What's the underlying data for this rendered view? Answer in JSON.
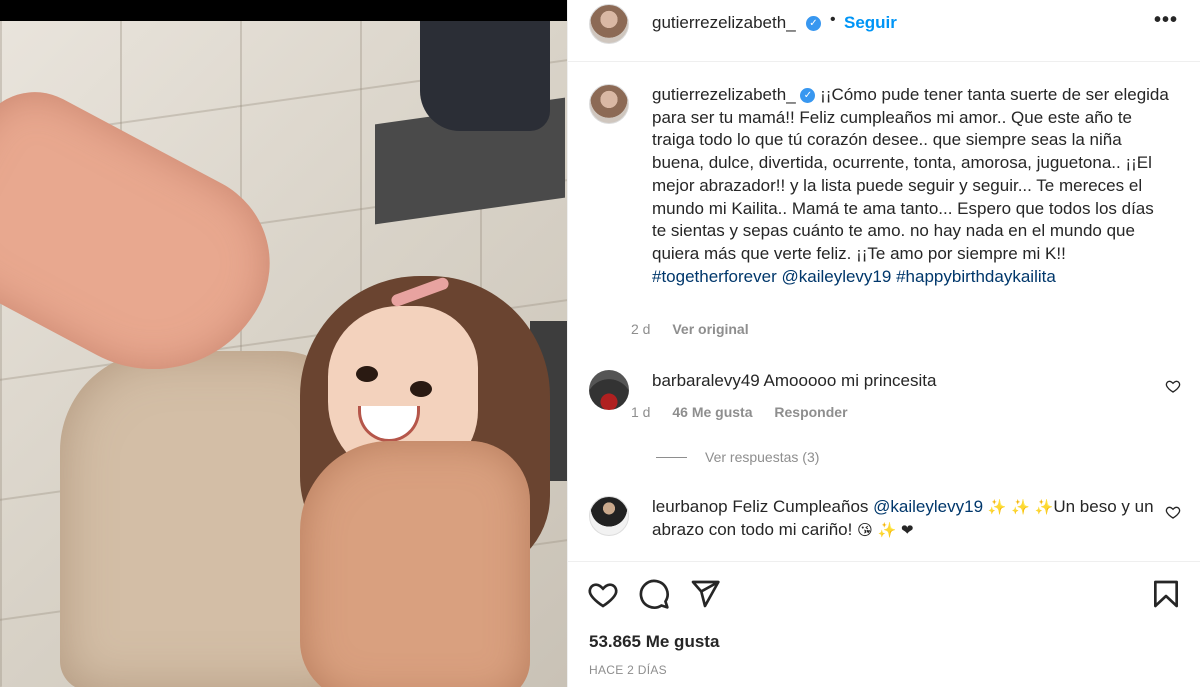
{
  "post": {
    "username": "gutierrezelizabeth_",
    "follow_label": "Seguir",
    "dot": "•",
    "more_label": "•••",
    "next_arrow": "›",
    "caption": {
      "text": "¡¡Cómo pude tener tanta suerte de ser elegida para ser tu mamá!! Feliz cumpleaños mi amor.. Que este año te traiga todo lo que tú corazón desee.. que siempre seas la niña buena, dulce, divertida, ocurrente, tonta, amorosa, juguetona.. ¡¡El mejor abrazador!! y la lista puede seguir y seguir... Te mereces el mundo mi Kailita.. Mamá te ama tanto... Espero que todos los días te sientas y sepas cuánto te amo. no hay nada en el mundo que quiera más que verte feliz. ¡¡Te amo por siempre mi K!!",
      "hashtag1": "#togetherforever",
      "mention": "@kaileylevy19",
      "hashtag2": "#happybirthdaykailita",
      "age": "2 d",
      "see_original": "Ver original"
    },
    "comments": [
      {
        "username": "barbaralevy49",
        "text": "Amooooo mi princesita",
        "age": "1 d",
        "likes": "46 Me gusta",
        "reply_label": "Responder",
        "view_replies": "Ver respuestas (3)"
      },
      {
        "username": "leurbanop",
        "text_before": "Feliz Cumpleaños",
        "mention": "@kaileylevy19",
        "emoji_sparkles": "✨ ✨ ✨",
        "text_after": "Un beso y un abrazo con todo mi cariño!",
        "emoji_end": "😘 ✨ ❤"
      }
    ],
    "likes_count": "53.865 Me gusta",
    "posted_ago": "HACE 2 DÍAS"
  },
  "colors": {
    "link_blue": "#0095f6",
    "hashtag": "#00376b",
    "muted": "#8e8e8e",
    "text": "#262626",
    "verified": "#3897f0"
  },
  "icons": [
    "verified-badge-icon",
    "more-options-icon",
    "next-arrow-icon",
    "heart-icon",
    "comment-icon",
    "share-icon",
    "bookmark-icon"
  ]
}
